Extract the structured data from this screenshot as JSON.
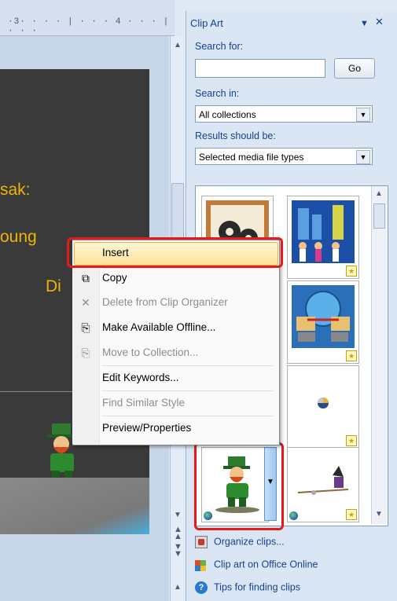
{
  "ruler": {
    "text": "·3· · · · | · · · 4 · · · | · · ·"
  },
  "slide": {
    "line1": "sak:",
    "line2": "oung",
    "line3": "Di"
  },
  "pane": {
    "title": "Clip Art",
    "dropdown_glyph": "▼",
    "close_glyph": "✕",
    "search_for_label": "Search for:",
    "search_value": "",
    "go_label": "Go",
    "search_in_label": "Search in:",
    "search_in_value": "All collections",
    "results_label": "Results should be:",
    "results_value": "Selected media file types"
  },
  "links": [
    {
      "label": "Organize clips..."
    },
    {
      "label": "Clip art on Office Online"
    },
    {
      "label": "Tips for finding clips"
    }
  ],
  "menu": {
    "items": [
      {
        "label": "Insert",
        "enabled": true
      },
      {
        "label": "Copy",
        "enabled": true
      },
      {
        "label": "Delete from Clip Organizer",
        "enabled": false
      },
      {
        "label": "Make Available Offline...",
        "enabled": true
      },
      {
        "label": "Move to Collection...",
        "enabled": false
      },
      {
        "label": "Edit Keywords...",
        "enabled": true
      },
      {
        "label": "Find Similar Style",
        "enabled": false
      },
      {
        "label": "Preview/Properties",
        "enabled": true
      }
    ]
  },
  "colors": {
    "accent": "#15428b",
    "highlight_border": "#e31b1b",
    "slide_text": "#f0b400"
  }
}
